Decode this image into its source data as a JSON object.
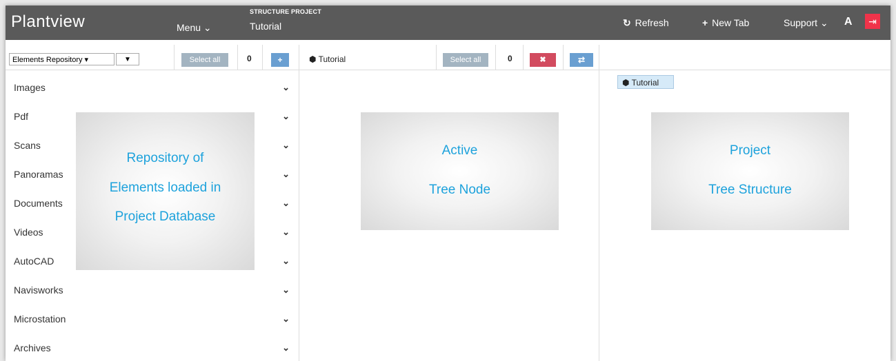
{
  "header": {
    "app_title": "Plantview",
    "menu_label": "Menu",
    "menu_chevron": "⌄",
    "project_caption": "STRUCTURE PROJECT",
    "project_name": "Tutorial",
    "refresh_label": "Refresh",
    "refresh_icon": "↻",
    "new_tab_label": "New Tab",
    "new_tab_icon": "+",
    "support_label": "Support",
    "support_chevron": "⌄",
    "user_initial": "A",
    "logout_icon": "⇥"
  },
  "repository": {
    "dropdown_value": "Elements Repository ▾",
    "filter_icon": "▼",
    "select_all_label": "Select all",
    "count": "0",
    "add_icon": "+",
    "categories": [
      {
        "label": "Images"
      },
      {
        "label": "Pdf"
      },
      {
        "label": "Scans"
      },
      {
        "label": "Panoramas"
      },
      {
        "label": "Documents"
      },
      {
        "label": "Videos"
      },
      {
        "label": "AutoCAD"
      },
      {
        "label": "Navisworks"
      },
      {
        "label": "Microstation"
      },
      {
        "label": "Archives"
      }
    ],
    "chevron_icon": "⌄",
    "overlay_lines": [
      "Repository of",
      "Elements loaded in",
      "Project Database"
    ]
  },
  "active_node": {
    "node_icon": "⬢",
    "title": "Tutorial",
    "select_all_label": "Select all",
    "count": "0",
    "delete_icon": "✖",
    "swap_icon": "⇄",
    "overlay_lines": [
      "Active",
      "Tree Node"
    ]
  },
  "tree": {
    "root_icon": "⬢",
    "root_label": "Tutorial",
    "overlay_lines": [
      "Project",
      "Tree Structure"
    ]
  },
  "colors": {
    "topbar": "#5a5a5a",
    "accent_blue": "#6a9fd1",
    "danger_red": "#d24b5f",
    "logout_red": "#f0334a",
    "overlay_text": "#1da2dc"
  }
}
